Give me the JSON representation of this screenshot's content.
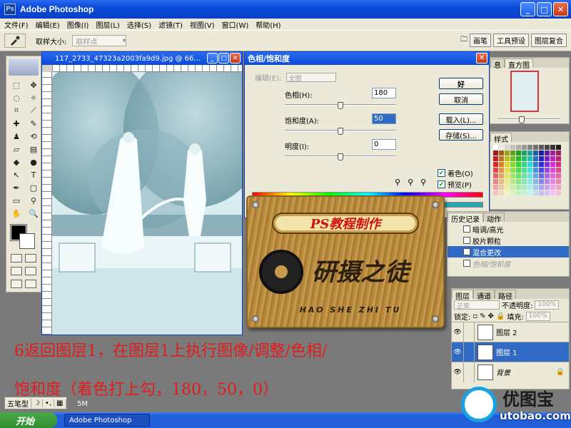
{
  "window": {
    "title": "Adobe Photoshop",
    "app_icon_text": "Ps",
    "minimize": "_",
    "maximize": "□",
    "close": "✕"
  },
  "menu": [
    "文件(F)",
    "编辑(E)",
    "图像(I)",
    "图层(L)",
    "选择(S)",
    "滤镜(T)",
    "视图(V)",
    "窗口(W)",
    "帮助(H)"
  ],
  "options_bar": {
    "sample_size_label": "取样大小:",
    "sample_size_value": "取样点",
    "palette_tabs": [
      "画笔",
      "工具预设",
      "图层复合"
    ]
  },
  "document": {
    "title": "117_2733_47323a2003fa9d9.jpg @ 66..."
  },
  "hue_sat_dialog": {
    "title": "色相/饱和度",
    "edit_label": "编辑(E):",
    "edit_value": "全图",
    "hue_label": "色相(H):",
    "hue_value": "180",
    "sat_label": "饱和度(A):",
    "sat_value": "50",
    "light_label": "明度(I):",
    "light_value": "0",
    "hue_slider_fraction": 0.5,
    "sat_slider_fraction": 0.5,
    "light_slider_fraction": 0.5,
    "ok_label": "好",
    "cancel_label": "取消",
    "load_label": "载入(L)...",
    "save_label": "存储(S)...",
    "colorize_label": "着色(O)",
    "colorize_checked": true,
    "preview_label": "预览(P)",
    "preview_checked": true
  },
  "navigator_panel": {
    "tabs": [
      "息",
      "直方图"
    ]
  },
  "swatches_panel": {
    "tabs": [
      "样式"
    ]
  },
  "history_panel": {
    "tabs": [
      "历史记录",
      "动作"
    ],
    "items": [
      {
        "label": "暗调/高光",
        "state": "normal"
      },
      {
        "label": "胶片颗粒",
        "state": "normal"
      },
      {
        "label": "混合更改",
        "state": "selected"
      },
      {
        "label": "色相/饱和度",
        "state": "faded"
      }
    ]
  },
  "layers_panel": {
    "tabs": [
      "图层",
      "通道",
      "路径"
    ],
    "blend_mode": "正常",
    "opacity_label": "不透明度:",
    "opacity_value": "100%",
    "lock_label": "锁定:",
    "fill_label": "填充:",
    "fill_value": "100%",
    "layers": [
      {
        "name": "图层 2",
        "selected": false
      },
      {
        "name": "图层 1",
        "selected": true
      },
      {
        "name": "背景",
        "selected": false
      }
    ]
  },
  "watermark": {
    "label": "PS教程制作",
    "brand": "研摄之徒",
    "pinyin": "HAO SHE ZHI TU"
  },
  "caption": {
    "line1": "6返回图层1，在图层1上执行图像/调整/色相/",
    "line2": "饱和度（着色打上勾，180，50，0）"
  },
  "statusbar": {
    "doc_size": "5M"
  },
  "ime": [
    "五笔型",
    "☽",
    "•,",
    "▦"
  ],
  "taskbar": {
    "start_label": "开始",
    "task_label": "Adobe Photoshop"
  },
  "site_logo": {
    "name": "优图宝",
    "url": "utobao.com"
  }
}
